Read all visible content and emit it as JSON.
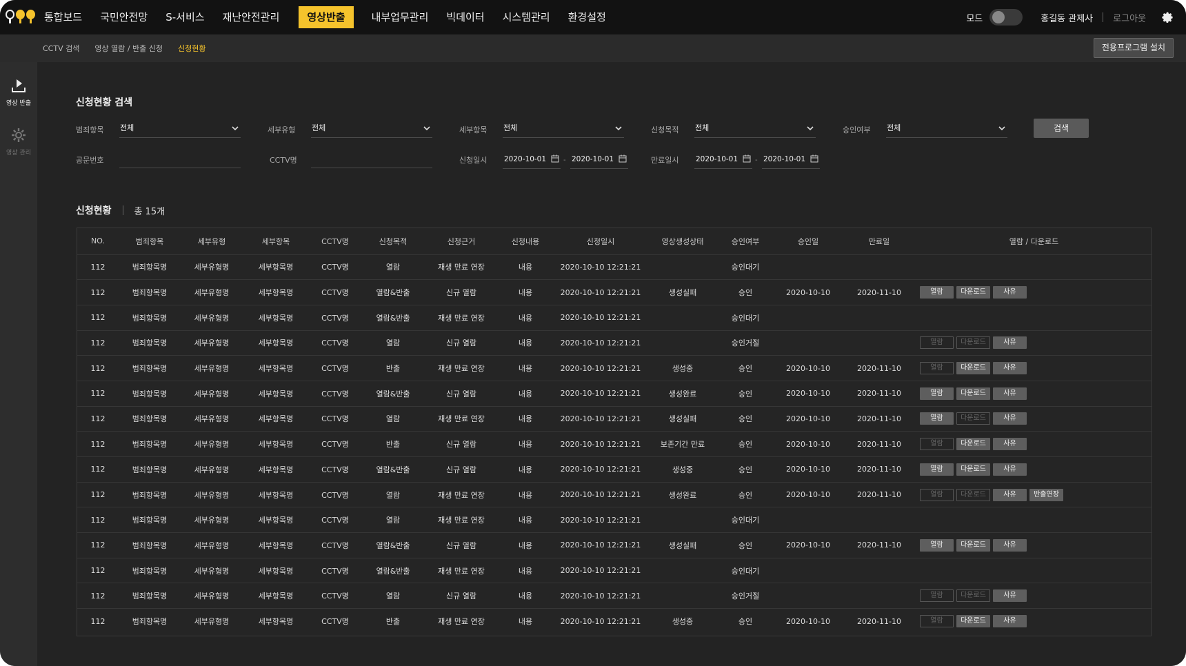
{
  "nav": {
    "menu": [
      "통합보드",
      "국민안전망",
      "S-서비스",
      "재난안전관리",
      "영상반출",
      "내부업무관리",
      "빅데이터",
      "시스템관리",
      "환경설정"
    ],
    "active_index": 4,
    "mode_label": "모드",
    "user": "홍길동 관제사",
    "logout": "로그아웃"
  },
  "breadcrumb": [
    "CCTV 검색",
    "영상 열람 / 반출 신청",
    "신청현황"
  ],
  "install_button": "전용프로그램 설치",
  "sidebar": [
    {
      "label": "영상 반출",
      "icon": "download-icon",
      "active": true
    },
    {
      "label": "영상 관리",
      "icon": "gear-icon",
      "active": false
    }
  ],
  "search": {
    "title": "신청현황 검색",
    "crime_label": "범죄항목",
    "crime_value": "전체",
    "subtype_label": "세부유형",
    "subtype_value": "전체",
    "subitem_label": "세부항목",
    "subitem_value": "전체",
    "purpose_label": "신청목적",
    "purpose_value": "전체",
    "approval_label": "승인여부",
    "approval_value": "전체",
    "search_button": "검색",
    "doc_label": "공문번호",
    "doc_value": "",
    "cctv_label": "CCTV명",
    "cctv_value": "",
    "apply_date_label": "신청일시",
    "apply_from": "2020-10-01",
    "apply_to": "2020-10-01",
    "expire_date_label": "만료일시",
    "expire_from": "2020-10-01",
    "expire_to": "2020-10-01",
    "range_sep": "-"
  },
  "results": {
    "title": "신청현황",
    "total": "총 15개",
    "columns": [
      "NO.",
      "범죄항목",
      "세부유형",
      "세부항목",
      "CCTV명",
      "신청목적",
      "신청근거",
      "신청내용",
      "신청일시",
      "영상생성상태",
      "승인여부",
      "승인일",
      "만료일",
      "열람 / 다운로드"
    ],
    "rows": [
      {
        "no": "112",
        "crime": "범죄항목명",
        "subtype": "세부유형명",
        "subitem": "세부항목명",
        "cctv": "CCTV명",
        "purpose": "열람",
        "basis": "재생 만료 연장",
        "content": "내용",
        "applied": "2020-10-10 12:21:21",
        "status": "",
        "approval": "승인대기",
        "approved": "",
        "expire": "",
        "buttons": []
      },
      {
        "no": "112",
        "crime": "범죄항목명",
        "subtype": "세부유형명",
        "subitem": "세부항목명",
        "cctv": "CCTV명",
        "purpose": "열람&반출",
        "basis": "신규 열람",
        "content": "내용",
        "applied": "2020-10-10 12:21:21",
        "status": "생성실패",
        "approval": "승인",
        "approved": "2020-10-10",
        "expire": "2020-11-10",
        "buttons": [
          {
            "label": "열람",
            "on": true
          },
          {
            "label": "다운로드",
            "on": true
          },
          {
            "label": "사유",
            "on": true
          }
        ]
      },
      {
        "no": "112",
        "crime": "범죄항목명",
        "subtype": "세부유형명",
        "subitem": "세부항목명",
        "cctv": "CCTV명",
        "purpose": "열람&반출",
        "basis": "재생 만료 연장",
        "content": "내용",
        "applied": "2020-10-10 12:21:21",
        "status": "",
        "approval": "승인대기",
        "approved": "",
        "expire": "",
        "buttons": []
      },
      {
        "no": "112",
        "crime": "범죄항목명",
        "subtype": "세부유형명",
        "subitem": "세부항목명",
        "cctv": "CCTV명",
        "purpose": "열람",
        "basis": "신규 열람",
        "content": "내용",
        "applied": "2020-10-10 12:21:21",
        "status": "",
        "approval": "승인거절",
        "approved": "",
        "expire": "",
        "buttons": [
          {
            "label": "열람",
            "on": false
          },
          {
            "label": "다운로드",
            "on": false
          },
          {
            "label": "사유",
            "on": true
          }
        ]
      },
      {
        "no": "112",
        "crime": "범죄항목명",
        "subtype": "세부유형명",
        "subitem": "세부항목명",
        "cctv": "CCTV명",
        "purpose": "반출",
        "basis": "재생 만료 연장",
        "content": "내용",
        "applied": "2020-10-10 12:21:21",
        "status": "생성중",
        "approval": "승인",
        "approved": "2020-10-10",
        "expire": "2020-11-10",
        "buttons": [
          {
            "label": "열람",
            "on": false
          },
          {
            "label": "다운로드",
            "on": true
          },
          {
            "label": "사유",
            "on": true
          }
        ]
      },
      {
        "no": "112",
        "crime": "범죄항목명",
        "subtype": "세부유형명",
        "subitem": "세부항목명",
        "cctv": "CCTV명",
        "purpose": "열람&반출",
        "basis": "신규 열람",
        "content": "내용",
        "applied": "2020-10-10 12:21:21",
        "status": "생성완료",
        "approval": "승인",
        "approved": "2020-10-10",
        "expire": "2020-11-10",
        "buttons": [
          {
            "label": "열람",
            "on": true
          },
          {
            "label": "다운로드",
            "on": true
          },
          {
            "label": "사유",
            "on": true
          }
        ]
      },
      {
        "no": "112",
        "crime": "범죄항목명",
        "subtype": "세부유형명",
        "subitem": "세부항목명",
        "cctv": "CCTV명",
        "purpose": "열람",
        "basis": "재생 만료 연장",
        "content": "내용",
        "applied": "2020-10-10 12:21:21",
        "status": "생성실패",
        "approval": "승인",
        "approved": "2020-10-10",
        "expire": "2020-11-10",
        "buttons": [
          {
            "label": "열람",
            "on": true
          },
          {
            "label": "다운로드",
            "on": false
          },
          {
            "label": "사유",
            "on": true
          }
        ]
      },
      {
        "no": "112",
        "crime": "범죄항목명",
        "subtype": "세부유형명",
        "subitem": "세부항목명",
        "cctv": "CCTV명",
        "purpose": "반출",
        "basis": "신규 열람",
        "content": "내용",
        "applied": "2020-10-10 12:21:21",
        "status": "보존기간 만료",
        "approval": "승인",
        "approved": "2020-10-10",
        "expire": "2020-11-10",
        "buttons": [
          {
            "label": "열람",
            "on": false
          },
          {
            "label": "다운로드",
            "on": true
          },
          {
            "label": "사유",
            "on": true
          }
        ]
      },
      {
        "no": "112",
        "crime": "범죄항목명",
        "subtype": "세부유형명",
        "subitem": "세부항목명",
        "cctv": "CCTV명",
        "purpose": "열람&반출",
        "basis": "신규 열람",
        "content": "내용",
        "applied": "2020-10-10 12:21:21",
        "status": "생성중",
        "approval": "승인",
        "approved": "2020-10-10",
        "expire": "2020-11-10",
        "buttons": [
          {
            "label": "열람",
            "on": true
          },
          {
            "label": "다운로드",
            "on": true
          },
          {
            "label": "사유",
            "on": true
          }
        ]
      },
      {
        "no": "112",
        "crime": "범죄항목명",
        "subtype": "세부유형명",
        "subitem": "세부항목명",
        "cctv": "CCTV명",
        "purpose": "열람",
        "basis": "재생 만료 연장",
        "content": "내용",
        "applied": "2020-10-10 12:21:21",
        "status": "생성완료",
        "approval": "승인",
        "approved": "2020-10-10",
        "expire": "2020-11-10",
        "buttons": [
          {
            "label": "열람",
            "on": false
          },
          {
            "label": "다운로드",
            "on": false
          },
          {
            "label": "사유",
            "on": true
          },
          {
            "label": "반출연장",
            "on": true
          }
        ]
      },
      {
        "no": "112",
        "crime": "범죄항목명",
        "subtype": "세부유형명",
        "subitem": "세부항목명",
        "cctv": "CCTV명",
        "purpose": "열람",
        "basis": "재생 만료 연장",
        "content": "내용",
        "applied": "2020-10-10 12:21:21",
        "status": "",
        "approval": "승인대기",
        "approved": "",
        "expire": "",
        "buttons": []
      },
      {
        "no": "112",
        "crime": "범죄항목명",
        "subtype": "세부유형명",
        "subitem": "세부항목명",
        "cctv": "CCTV명",
        "purpose": "열람&반출",
        "basis": "신규 열람",
        "content": "내용",
        "applied": "2020-10-10 12:21:21",
        "status": "생성실패",
        "approval": "승인",
        "approved": "2020-10-10",
        "expire": "2020-11-10",
        "buttons": [
          {
            "label": "열람",
            "on": true
          },
          {
            "label": "다운로드",
            "on": true
          },
          {
            "label": "사유",
            "on": true
          }
        ]
      },
      {
        "no": "112",
        "crime": "범죄항목명",
        "subtype": "세부유형명",
        "subitem": "세부항목명",
        "cctv": "CCTV명",
        "purpose": "열람&반출",
        "basis": "재생 만료 연장",
        "content": "내용",
        "applied": "2020-10-10 12:21:21",
        "status": "",
        "approval": "승인대기",
        "approved": "",
        "expire": "",
        "buttons": []
      },
      {
        "no": "112",
        "crime": "범죄항목명",
        "subtype": "세부유형명",
        "subitem": "세부항목명",
        "cctv": "CCTV명",
        "purpose": "열람",
        "basis": "신규 열람",
        "content": "내용",
        "applied": "2020-10-10 12:21:21",
        "status": "",
        "approval": "승인거절",
        "approved": "",
        "expire": "",
        "buttons": [
          {
            "label": "열람",
            "on": false
          },
          {
            "label": "다운로드",
            "on": false
          },
          {
            "label": "사유",
            "on": true
          }
        ]
      },
      {
        "no": "112",
        "crime": "범죄항목명",
        "subtype": "세부유형명",
        "subitem": "세부항목명",
        "cctv": "CCTV명",
        "purpose": "반출",
        "basis": "재생 만료 연장",
        "content": "내용",
        "applied": "2020-10-10 12:21:21",
        "status": "생성중",
        "approval": "승인",
        "approved": "2020-10-10",
        "expire": "2020-11-10",
        "buttons": [
          {
            "label": "열람",
            "on": false
          },
          {
            "label": "다운로드",
            "on": true
          },
          {
            "label": "사유",
            "on": true
          }
        ]
      }
    ]
  },
  "colors": {
    "accent": "#f5c32c",
    "bg": "#232323",
    "topbar": "#121212"
  }
}
